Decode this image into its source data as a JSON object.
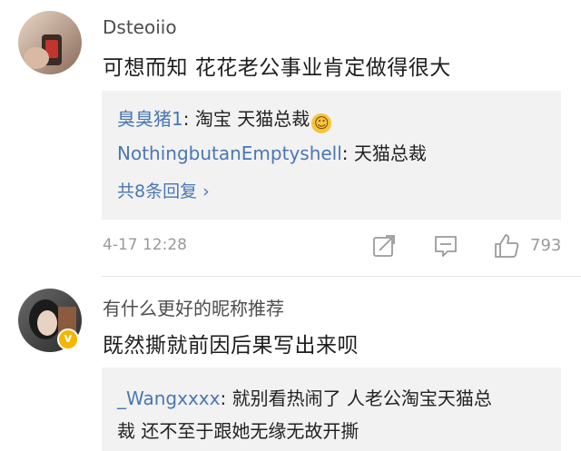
{
  "comments": [
    {
      "username": "Dsteoiio",
      "text": "可想而知 花花老公事业肯定做得很大",
      "replies": [
        {
          "user": "臭臭猪1",
          "separator": ": ",
          "text": "淘宝 天猫总裁",
          "emoji": "☺"
        },
        {
          "user": "NothingbutanEmptyshell",
          "separator": ": ",
          "text": "天猫总裁"
        }
      ],
      "more_replies": "共8条回复 ›",
      "timestamp": "4-17 12:28",
      "like_count": "793"
    },
    {
      "username": "有什么更好的昵称推荐",
      "text": "既然撕就前因后果写出来呗",
      "verified_badge": "v",
      "replies": [
        {
          "user": "_Wangxxxx",
          "separator": ": ",
          "text_line1": "就别看热闹了 人老公淘宝天猫总",
          "text_line2": "裁 还不至于跟她无缘无故开撕"
        }
      ]
    }
  ],
  "colors": {
    "link": "#4a77b4",
    "meta": "#9a9a9a",
    "reply_bg": "#f2f2f2",
    "badge": "#f7b500"
  },
  "icons": [
    "share-icon",
    "comment-icon",
    "like-icon"
  ]
}
